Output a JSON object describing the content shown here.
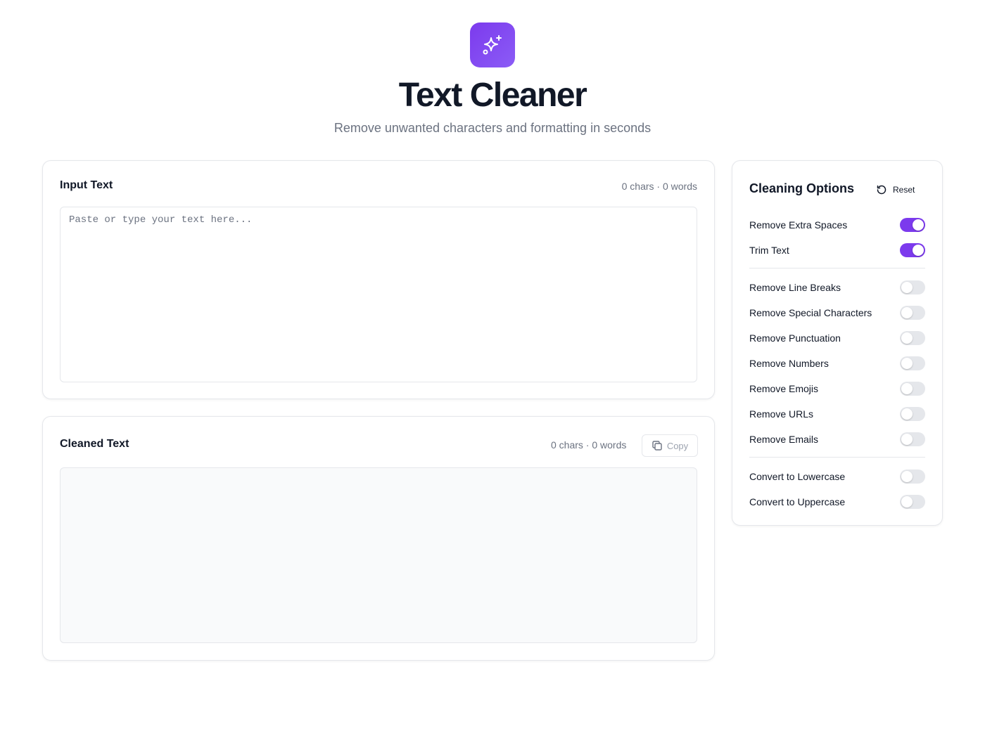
{
  "colors": {
    "accent": "#7c3aed",
    "border": "#e5e7eb",
    "muted": "#6b7280"
  },
  "header": {
    "logo_icon": "sparkles-icon",
    "title": "Text Cleaner",
    "subtitle": "Remove unwanted characters and formatting in seconds"
  },
  "input": {
    "title": "Input Text",
    "counts": "0 chars · 0 words",
    "value": "",
    "placeholder": "Paste or type your text here..."
  },
  "output": {
    "title": "Cleaned Text",
    "counts": "0 chars · 0 words",
    "copy_label": "Copy",
    "copy_icon": "copy-icon",
    "value": ""
  },
  "options": {
    "title": "Cleaning Options",
    "reset_label": "Reset",
    "reset_icon": "rotate-ccw-icon",
    "groups": [
      [
        {
          "label": "Remove Extra Spaces",
          "on": true
        },
        {
          "label": "Trim Text",
          "on": true
        }
      ],
      [
        {
          "label": "Remove Line Breaks",
          "on": false
        },
        {
          "label": "Remove Special Characters",
          "on": false
        },
        {
          "label": "Remove Punctuation",
          "on": false
        },
        {
          "label": "Remove Numbers",
          "on": false
        },
        {
          "label": "Remove Emojis",
          "on": false
        },
        {
          "label": "Remove URLs",
          "on": false
        },
        {
          "label": "Remove Emails",
          "on": false
        }
      ],
      [
        {
          "label": "Convert to Lowercase",
          "on": false
        },
        {
          "label": "Convert to Uppercase",
          "on": false
        }
      ]
    ]
  }
}
